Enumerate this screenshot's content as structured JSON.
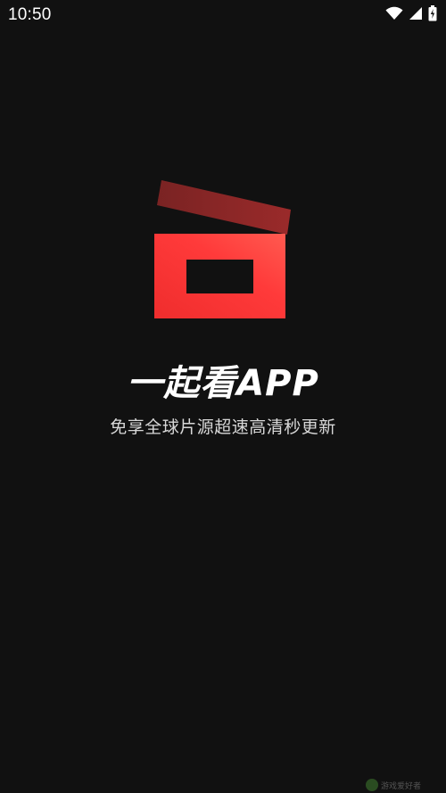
{
  "status_bar": {
    "time": "10:50",
    "icons": [
      "wifi-icon",
      "cellular-signal-icon",
      "battery-charging-icon"
    ]
  },
  "splash": {
    "logo": "clapperboard-logo",
    "title": "一起看APP",
    "tagline": "免享全球片源超速高清秒更新"
  },
  "watermark": {
    "text": "游戏爱好者"
  },
  "colors": {
    "background": "#111111",
    "logo_red": "#ff3b3b",
    "logo_dark_red": "#8b2626",
    "text": "#ffffff",
    "subtext": "#d8d8d8"
  }
}
